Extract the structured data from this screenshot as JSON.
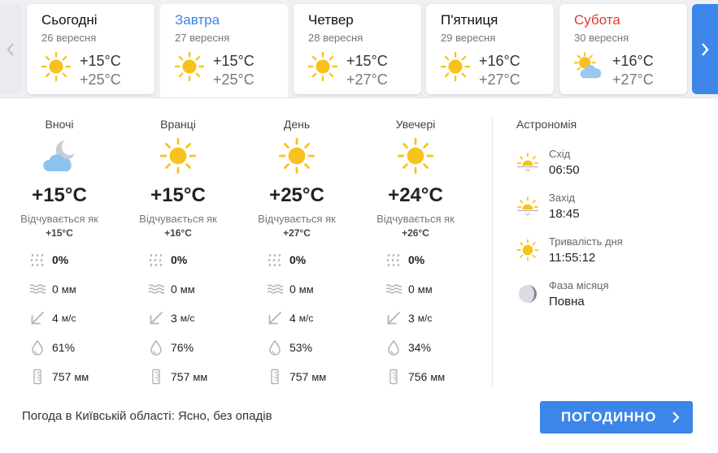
{
  "days": [
    {
      "name": "Сьогодні",
      "date": "26 вересня",
      "min": "+15°C",
      "max": "+25°C",
      "icon": "sun-icon"
    },
    {
      "name": "Завтра",
      "date": "27 вересня",
      "min": "+15°C",
      "max": "+25°C",
      "icon": "sun-icon"
    },
    {
      "name": "Четвер",
      "date": "28 вересня",
      "min": "+15°C",
      "max": "+27°C",
      "icon": "sun-icon"
    },
    {
      "name": "П'ятниця",
      "date": "29 вересня",
      "min": "+16°C",
      "max": "+27°C",
      "icon": "sun-icon"
    },
    {
      "name": "Субота",
      "date": "30 вересня",
      "min": "+16°C",
      "max": "+27°C",
      "icon": "sun-cloud-icon"
    }
  ],
  "nav": {
    "prev_icon": "chevron-left-icon",
    "next_icon": "chevron-right-icon"
  },
  "periods": [
    {
      "label": "Вночі",
      "icon": "moon-cloud-icon",
      "temp": "+15°C",
      "feels_label": "Відчувається як",
      "feels": "+15°C",
      "precip_prob": "0%",
      "precip_amount": "0",
      "precip_unit": "мм",
      "wind": "4",
      "wind_unit": "м/с",
      "humidity": "61%",
      "pressure": "757",
      "pressure_unit": "мм"
    },
    {
      "label": "Вранці",
      "icon": "sun-icon",
      "temp": "+15°C",
      "feels_label": "Відчувається як",
      "feels": "+16°C",
      "precip_prob": "0%",
      "precip_amount": "0",
      "precip_unit": "мм",
      "wind": "3",
      "wind_unit": "м/с",
      "humidity": "76%",
      "pressure": "757",
      "pressure_unit": "мм"
    },
    {
      "label": "День",
      "icon": "sun-icon",
      "temp": "+25°C",
      "feels_label": "Відчувається як",
      "feels": "+27°C",
      "precip_prob": "0%",
      "precip_amount": "0",
      "precip_unit": "мм",
      "wind": "4",
      "wind_unit": "м/с",
      "humidity": "53%",
      "pressure": "757",
      "pressure_unit": "мм"
    },
    {
      "label": "Увечері",
      "icon": "sun-icon",
      "temp": "+24°C",
      "feels_label": "Відчувається як",
      "feels": "+26°C",
      "precip_prob": "0%",
      "precip_amount": "0",
      "precip_unit": "мм",
      "wind": "3",
      "wind_unit": "м/с",
      "humidity": "34%",
      "pressure": "756",
      "pressure_unit": "мм"
    }
  ],
  "astronomy": {
    "title": "Астрономія",
    "sunrise_label": "Схід",
    "sunrise": "06:50",
    "sunset_label": "Захід",
    "sunset": "18:45",
    "daylength_label": "Тривалість дня",
    "daylength": "11:55:12",
    "moon_label": "Фаза місяця",
    "moon": "Повна"
  },
  "summary": "Погода в Київській області: Ясно, без опадів",
  "hourly_button": "погодинно",
  "colors": {
    "accent": "#3c86ea",
    "weekend": "#e53935",
    "sun": "#f8c21c",
    "icon_gray": "#b0b5bd"
  }
}
